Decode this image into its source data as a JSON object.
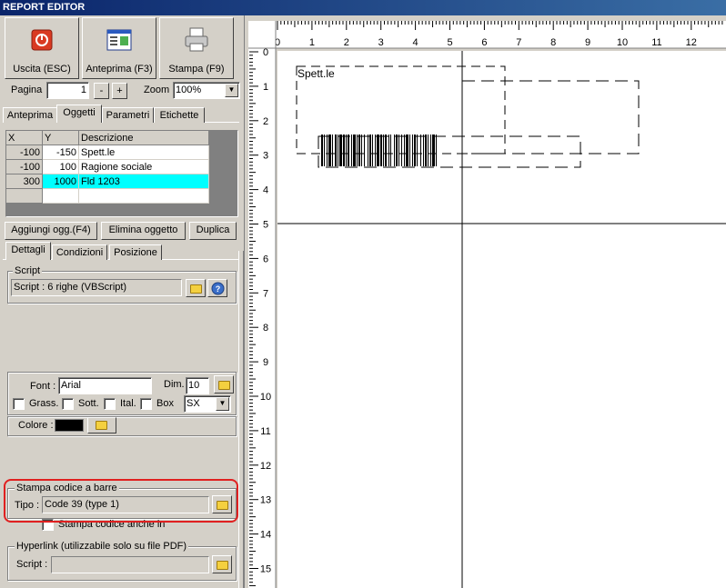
{
  "window": {
    "title": "REPORT EDITOR"
  },
  "toolbar": {
    "exit_label": "Uscita (ESC)",
    "preview_label": "Anteprima (F3)",
    "print_label": "Stampa (F9)"
  },
  "paging": {
    "page_label": "Pagina",
    "page_value": "1",
    "minus": "-",
    "plus": "+",
    "zoom_label": "Zoom",
    "zoom_value": "100%"
  },
  "tabs": {
    "preview": "Anteprima",
    "objects": "Oggetti",
    "params": "Parametri",
    "labels": "Etichette"
  },
  "objects_table": {
    "headers": [
      "X",
      "Y",
      "Descrizione"
    ],
    "rows": [
      {
        "x": "-100",
        "y": "-150",
        "desc": "Spett.le"
      },
      {
        "x": "-100",
        "y": "100",
        "desc": "Ragione sociale"
      },
      {
        "x": "300",
        "y": "1000",
        "desc": "Fld 1203"
      }
    ]
  },
  "object_buttons": {
    "add": "Aggiungi ogg.(F4)",
    "delete": "Elimina oggetto",
    "duplicate": "Duplica"
  },
  "detail_tabs": {
    "details": "Dettagli",
    "conditions": "Condizioni",
    "position": "Posizione"
  },
  "script": {
    "group_label": "Script",
    "value": "Script : 6 righe (VBScript)"
  },
  "font": {
    "label": "Font :",
    "value": "Arial",
    "dim_label": "Dim.",
    "dim_value": "10",
    "bold": "Grass.",
    "underline": "Sott.",
    "italic": "Ital.",
    "box": "Box",
    "align_value": "SX"
  },
  "color": {
    "label": "Colore :",
    "swatch": "#000000"
  },
  "barcode": {
    "group_label": "Stampa codice a barre",
    "type_label": "Tipo :",
    "type_value": "Code 39 (type 1)",
    "also_chars": "Stampa codice anche in caratteri"
  },
  "hyperlink": {
    "group_label": "Hyperlink (utilizzabile solo su file PDF)",
    "script_label": "Script :",
    "script_value": ""
  },
  "ruler": {
    "h_ticks": [
      "0",
      "1",
      "2",
      "3",
      "4",
      "5",
      "6",
      "7",
      "8",
      "9",
      "10",
      "11",
      "12"
    ],
    "v_ticks": [
      "0",
      "1",
      "2",
      "3",
      "4",
      "5",
      "6",
      "7",
      "8",
      "9",
      "10",
      "11",
      "12",
      "13",
      "14",
      "15"
    ]
  },
  "canvas": {
    "text1": "Spett.le"
  },
  "colors": {
    "highlight": "#00ffff",
    "annotation": "#e02020",
    "title_bar": "#0a246a"
  }
}
